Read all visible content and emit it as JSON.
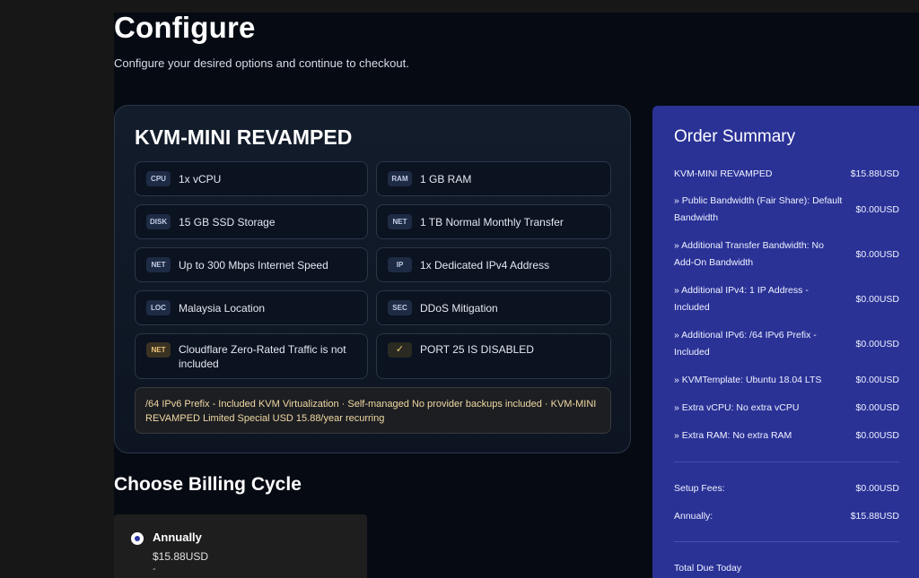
{
  "page": {
    "title": "Configure",
    "subtitle": "Configure your desired options and continue to checkout."
  },
  "product": {
    "name": "KVM-MINI REVAMPED",
    "features": [
      {
        "tag": "CPU",
        "text": "1x vCPU"
      },
      {
        "tag": "RAM",
        "text": "1 GB RAM"
      },
      {
        "tag": "DISK",
        "text": "15 GB SSD Storage"
      },
      {
        "tag": "NET",
        "text": "1 TB Normal Monthly Transfer"
      },
      {
        "tag": "NET",
        "text": "Up to 300 Mbps Internet Speed"
      },
      {
        "tag": "IP",
        "text": "1x Dedicated IPv4 Address"
      },
      {
        "tag": "LOC",
        "text": "Malaysia Location"
      },
      {
        "tag": "SEC",
        "text": "DDoS Mitigation"
      },
      {
        "tag": "NET",
        "text": "Cloudflare Zero-Rated Traffic is not included"
      },
      {
        "tag": "✓",
        "text": "PORT 25 IS DISABLED"
      }
    ],
    "note": "/64 IPv6 Prefix - Included KVM Virtualization · Self-managed No provider backups included · KVM-MINI REVAMPED Limited Special USD 15.88/year recurring"
  },
  "billing": {
    "section_title": "Choose Billing Cycle",
    "option": {
      "label": "Annually",
      "price": "$15.88USD",
      "extra": "-"
    }
  },
  "summary": {
    "title": "Order Summary",
    "lines": [
      {
        "label": "KVM-MINI REVAMPED",
        "value": "$15.88USD"
      },
      {
        "label": " » Public Bandwidth (Fair Share): Default Bandwidth",
        "value": "$0.00USD"
      },
      {
        "label": " » Additional Transfer Bandwidth: No Add-On Bandwidth",
        "value": "$0.00USD"
      },
      {
        "label": " » Additional IPv4: 1 IP Address - Included",
        "value": "$0.00USD"
      },
      {
        "label": " » Additional IPv6: /64 IPv6 Prefix - Included",
        "value": "$0.00USD"
      },
      {
        "label": " » KVMTemplate: Ubuntu 18.04 LTS",
        "value": "$0.00USD"
      },
      {
        "label": " » Extra vCPU: No extra vCPU",
        "value": "$0.00USD"
      },
      {
        "label": " » Extra RAM: No extra RAM",
        "value": "$0.00USD"
      }
    ],
    "setup_fees": {
      "label": "Setup Fees:",
      "value": "$0.00USD"
    },
    "annually": {
      "label": "Annually:",
      "value": "$15.88USD"
    },
    "total_label": "Total Due Today"
  }
}
